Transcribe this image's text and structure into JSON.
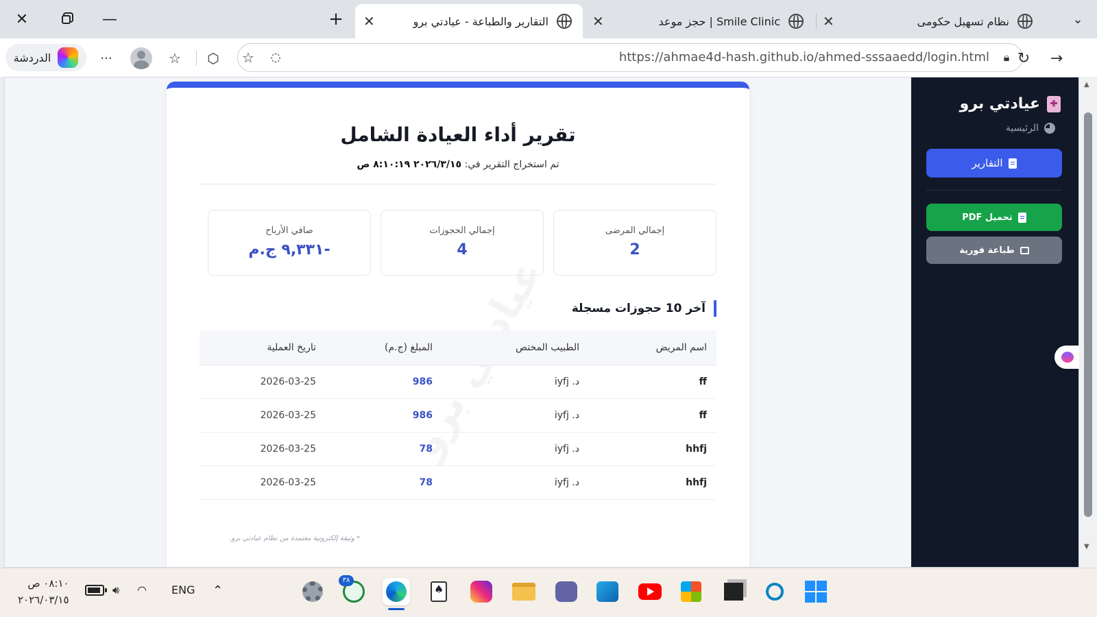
{
  "browser": {
    "tabs": [
      {
        "title": "نظام تسهيل حكومى"
      },
      {
        "title": "Smile Clinic | حجز موعد"
      },
      {
        "title": "التقارير والطباعة - عيادتي برو",
        "active": true
      }
    ],
    "url_host": "https://ahmae4d-hash.github.io",
    "url_path": "/ahmed-sssaaedd/login.html",
    "chat_label": "الدردشة",
    "more_label": "···"
  },
  "sidebar": {
    "brand": "عيادتي برو",
    "home": "الرئيسية",
    "reports": "التقارير",
    "pdf": "تحميل PDF",
    "print": "طباعة فورية"
  },
  "report": {
    "watermark": "عيادتي برو",
    "title": "تقرير أداء العيادة الشامل",
    "date_prefix": "تم استخراج التقرير في:",
    "date_value": "٢٠٢٦/٣/١٥ ٨:١٠:١٩ ص",
    "stats": [
      {
        "label": "إجمالي المرضى",
        "value": "2"
      },
      {
        "label": "إجمالي الحجوزات",
        "value": "4"
      },
      {
        "label": "صافي الأرباح",
        "value": "-٩,٣٣١ ج.م"
      }
    ],
    "section_title": "آخر 10 حجوزات مسجلة",
    "columns": [
      "اسم المريض",
      "الطبيب المختص",
      "المبلغ (ج.م)",
      "تاريخ العملية"
    ],
    "rows": [
      [
        "ff",
        "د. iyfj",
        "986",
        "2026-03-25"
      ],
      [
        "ff",
        "د. iyfj",
        "986",
        "2026-03-25"
      ],
      [
        "hhfj",
        "د. iyfj",
        "78",
        "2026-03-25"
      ],
      [
        "hhfj",
        "د. iyfj",
        "78",
        "2026-03-25"
      ]
    ],
    "footer": "* وثيقة إلكترونية معتمدة من نظام عيادتي برو."
  },
  "taskbar": {
    "time": "٠٨:١٠ ص",
    "date": "٢٠٢٦/٠٣/١٥",
    "lang": "ENG",
    "whatsapp_badge": "٣٨"
  },
  "colors": {
    "accent": "#3b5bea",
    "sidebar_bg": "#111827",
    "pdf_button": "#16a34a",
    "print_button": "#6b7280",
    "stat_value": "#3b52c4"
  }
}
